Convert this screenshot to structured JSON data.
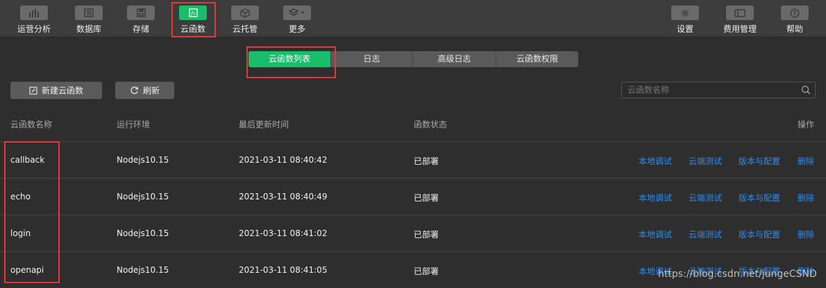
{
  "toolbar": {
    "items": [
      {
        "label": "运营分析",
        "icon": "chart-icon"
      },
      {
        "label": "数据库",
        "icon": "database-icon"
      },
      {
        "label": "存储",
        "icon": "save-icon"
      },
      {
        "label": "云函数",
        "icon": "function-icon",
        "active": true
      },
      {
        "label": "云托管",
        "icon": "cube-icon"
      },
      {
        "label": "更多",
        "icon": "layers-icon"
      }
    ],
    "right_items": [
      {
        "label": "设置",
        "icon": "gear-icon"
      },
      {
        "label": "费用管理",
        "icon": "billing-icon"
      },
      {
        "label": "帮助",
        "icon": "help-icon"
      }
    ]
  },
  "tabs": [
    {
      "label": "云函数列表",
      "active": true
    },
    {
      "label": "日志"
    },
    {
      "label": "高级日志"
    },
    {
      "label": "云函数权限"
    }
  ],
  "actions": {
    "new_label": "新建云函数",
    "refresh_label": "刷新"
  },
  "search": {
    "placeholder": "云函数名称",
    "value": ""
  },
  "table": {
    "headers": {
      "name": "云函数名称",
      "runtime": "运行环境",
      "updated": "最后更新时间",
      "status": "函数状态",
      "ops": "操作"
    },
    "op_labels": {
      "local_debug": "本地调试",
      "cloud_test": "云端测试",
      "version_config": "版本与配置",
      "delete": "删除"
    },
    "rows": [
      {
        "name": "callback",
        "runtime": "Nodejs10.15",
        "updated": "2021-03-11 08:40:42",
        "status": "已部署"
      },
      {
        "name": "echo",
        "runtime": "Nodejs10.15",
        "updated": "2021-03-11 08:40:49",
        "status": "已部署"
      },
      {
        "name": "login",
        "runtime": "Nodejs10.15",
        "updated": "2021-03-11 08:41:02",
        "status": "已部署"
      },
      {
        "name": "openapi",
        "runtime": "Nodejs10.15",
        "updated": "2021-03-11 08:41:05",
        "status": "已部署"
      }
    ]
  },
  "watermark": "https://blog.csdn.net/jungeCSND",
  "colors": {
    "accent": "#19be6b",
    "link": "#2d8cf0",
    "highlight": "#e5383b"
  }
}
